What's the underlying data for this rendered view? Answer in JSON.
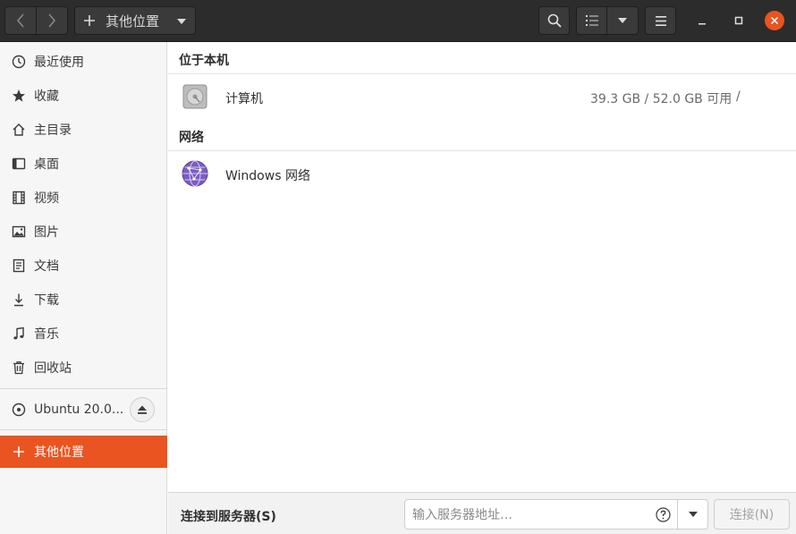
{
  "header": {
    "location_label": "其他位置",
    "icons": [
      "go-back-icon",
      "go-forward-icon",
      "plus-icon",
      "search-icon",
      "list-view-icon",
      "chevron-down-icon",
      "hamburger-menu-icon",
      "minimize-icon",
      "maximize-icon",
      "close-icon"
    ]
  },
  "sidebar": {
    "items": [
      {
        "label": "最近使用",
        "icon": "clock-icon"
      },
      {
        "label": "收藏",
        "icon": "star-icon"
      },
      {
        "label": "主目录",
        "icon": "home-icon"
      },
      {
        "label": "桌面",
        "icon": "desktop-icon"
      },
      {
        "label": "视频",
        "icon": "film-icon"
      },
      {
        "label": "图片",
        "icon": "image-icon"
      },
      {
        "label": "文档",
        "icon": "document-icon"
      },
      {
        "label": "下载",
        "icon": "download-icon"
      },
      {
        "label": "音乐",
        "icon": "music-icon"
      },
      {
        "label": "回收站",
        "icon": "trash-icon"
      }
    ],
    "device": {
      "label": "Ubuntu 20.0...",
      "icon": "optical-disc-icon"
    },
    "other_locations": {
      "label": "其他位置",
      "icon": "plus-icon"
    }
  },
  "main": {
    "local_section_title": "位于本机",
    "computer": {
      "name": "计算机",
      "usage": "39.3 GB / 52.0 GB 可用",
      "path": "/"
    },
    "network_section_title": "网络",
    "windows_network": {
      "name": "Windows 网络"
    }
  },
  "footer": {
    "connect_label": "连接到服务器(S)",
    "server_placeholder": "输入服务器地址…",
    "connect_button": "连接(N)"
  },
  "colors": {
    "accent": "#e95420",
    "headerbar": "#2c2c2c",
    "sidebar_bg": "#f6f6f6"
  }
}
